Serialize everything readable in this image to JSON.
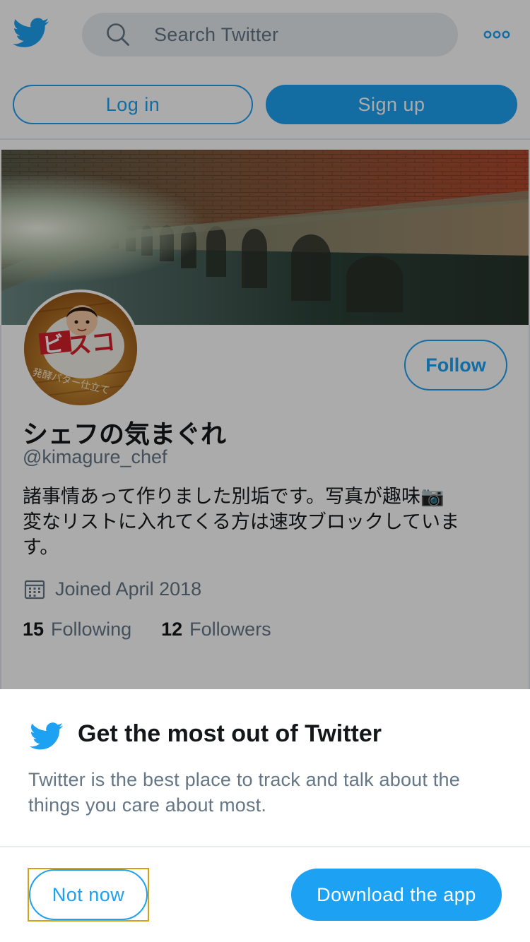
{
  "header": {
    "logo_icon": "twitter-bird-icon",
    "search_placeholder": "Search Twitter",
    "more_icon": "more-dots-icon",
    "login_label": "Log in",
    "signup_label": "Sign up"
  },
  "profile": {
    "follow_label": "Follow",
    "display_name": "シェフの気まぐれ",
    "handle": "@kimagure_chef",
    "bio_line1": "諸事情あって作りました別垢です。写真が趣味📷",
    "bio_line2": "変なリストに入れてくる方は速攻ブロックしていま",
    "bio_line3": "す。",
    "joined": "Joined April 2018",
    "following_count": "15",
    "following_label": "Following",
    "followers_count": "12",
    "followers_label": "Followers"
  },
  "prompt": {
    "title": "Get the most out of Twitter",
    "description": "Twitter is the best place to track and talk about the things you care about most.",
    "not_now_label": "Not now",
    "download_label": "Download the app"
  },
  "colors": {
    "brand_blue": "#1da1f2",
    "text_primary": "#14171a",
    "text_secondary": "#657786",
    "overlay": "rgba(0,0,0,0.33)"
  }
}
